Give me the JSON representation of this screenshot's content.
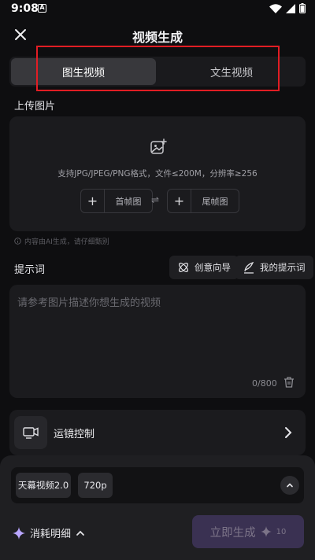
{
  "status_bar": {
    "time": "9:08",
    "notification_letter": "A"
  },
  "header": {
    "title": "视频生成",
    "close_icon": "close-icon"
  },
  "tabs": [
    {
      "label": "图生视频",
      "active": true
    },
    {
      "label": "文生视频",
      "active": false
    }
  ],
  "upload": {
    "section_label": "上传图片",
    "hint": "支持JPG/JPEG/PNG格式，文件≤200M，分辨率≥256",
    "first_frame": {
      "plus": "+",
      "label": "首帧图"
    },
    "swap_symbol": "⇌",
    "last_frame": {
      "plus": "+",
      "label": "尾帧图"
    },
    "ai_notice": "内容由AI生成，请仔细甄别"
  },
  "prompt": {
    "section_label": "提示词",
    "creative_guide_label": "创意向导",
    "my_prompts_label": "我的提示词",
    "placeholder": "请参考图片描述你想生成的视频",
    "char_count": "0/800"
  },
  "camera_control": {
    "label": "运镜控制"
  },
  "bottom": {
    "model_chip": "天幕视频2.0",
    "resolution_chip": "720p",
    "consume_label": "消耗明细",
    "generate_label": "立即生成",
    "generate_cost": "10"
  },
  "colors": {
    "background": "#0e0e10",
    "card": "#1b1b1e",
    "highlight_box": "#e11d24",
    "generate_button": "#3a3152",
    "sparkle": "#b9a6ff"
  }
}
